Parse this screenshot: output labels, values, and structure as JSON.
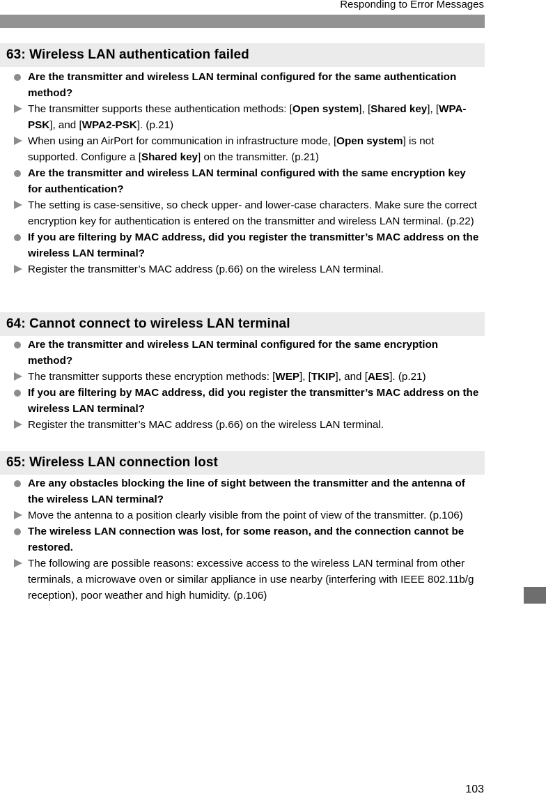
{
  "running_head": "Responding to Error Messages",
  "page_number": "103",
  "sections": [
    {
      "title": "63:  Wireless LAN authentication failed",
      "items": [
        {
          "type": "question",
          "segments": [
            {
              "t": "Are the transmitter and wireless LAN terminal configured for the same authentication method?"
            }
          ]
        },
        {
          "type": "answer",
          "segments": [
            {
              "t": "The transmitter supports these authentication methods: ["
            },
            {
              "t": "Open system",
              "b": true
            },
            {
              "t": "], ["
            },
            {
              "t": "Shared key",
              "b": true
            },
            {
              "t": "], ["
            },
            {
              "t": "WPA-PSK",
              "b": true
            },
            {
              "t": "], and ["
            },
            {
              "t": "WPA2-PSK",
              "b": true
            },
            {
              "t": "]. (p.21)"
            }
          ]
        },
        {
          "type": "answer",
          "segments": [
            {
              "t": "When using an AirPort for communication in infrastructure mode, ["
            },
            {
              "t": "Open system",
              "b": true
            },
            {
              "t": "] is not supported. Configure a ["
            },
            {
              "t": "Shared key",
              "b": true
            },
            {
              "t": "] on the transmitter. (p.21)"
            }
          ]
        },
        {
          "type": "question",
          "segments": [
            {
              "t": "Are the transmitter and wireless LAN terminal configured with the same encryption key for authentication?"
            }
          ]
        },
        {
          "type": "answer",
          "segments": [
            {
              "t": "The setting is case-sensitive, so check upper- and lower-case characters. Make sure the correct encryption key for authentication is entered on the transmitter and wireless LAN terminal. (p.22)"
            }
          ]
        },
        {
          "type": "question",
          "segments": [
            {
              "t": "If you are filtering by MAC address, did you register the transmitter’s MAC address on the wireless LAN terminal?"
            }
          ]
        },
        {
          "type": "answer",
          "segments": [
            {
              "t": "Register the transmitter’s MAC address (p.66) on the wireless LAN terminal."
            }
          ]
        }
      ]
    },
    {
      "title": "64:  Cannot connect to wireless LAN terminal",
      "items": [
        {
          "type": "question",
          "segments": [
            {
              "t": "Are the transmitter and wireless LAN terminal configured for the same encryption method?"
            }
          ]
        },
        {
          "type": "answer",
          "segments": [
            {
              "t": "The transmitter supports these encryption methods: ["
            },
            {
              "t": "WEP",
              "b": true
            },
            {
              "t": "], ["
            },
            {
              "t": "TKIP",
              "b": true
            },
            {
              "t": "], and ["
            },
            {
              "t": "AES",
              "b": true
            },
            {
              "t": "]. (p.21)"
            }
          ]
        },
        {
          "type": "question",
          "segments": [
            {
              "t": "If you are filtering by MAC address, did you register the transmitter’s MAC address on the wireless LAN terminal?"
            }
          ]
        },
        {
          "type": "answer",
          "segments": [
            {
              "t": "Register the transmitter’s MAC address (p.66) on the wireless LAN terminal."
            }
          ]
        }
      ]
    },
    {
      "title": "65:  Wireless LAN connection lost",
      "items": [
        {
          "type": "question",
          "segments": [
            {
              "t": "Are any obstacles blocking the line of sight between the transmitter and the antenna of the wireless LAN terminal?"
            }
          ]
        },
        {
          "type": "answer",
          "segments": [
            {
              "t": "Move the antenna to a position clearly visible from the point of view of the transmitter. (p.106)"
            }
          ]
        },
        {
          "type": "question",
          "segments": [
            {
              "t": "The wireless LAN connection was lost, for some reason, and the connection cannot be restored."
            }
          ]
        },
        {
          "type": "answer",
          "segments": [
            {
              "t": "The following are possible reasons: excessive access to the wireless LAN terminal from other terminals, a microwave oven or similar appliance in use nearby (interfering with IEEE 802.11b/g reception), poor weather and high humidity. (p.106)"
            }
          ]
        }
      ]
    }
  ],
  "icons": {
    "question": "bullet-dot-icon",
    "answer": "triangle-arrow-icon"
  },
  "colors": {
    "top_bar": "#939393",
    "section_header_bg": "#ebebeb",
    "marker": "#8c8c8c",
    "side_tab": "#6e6e6e"
  }
}
